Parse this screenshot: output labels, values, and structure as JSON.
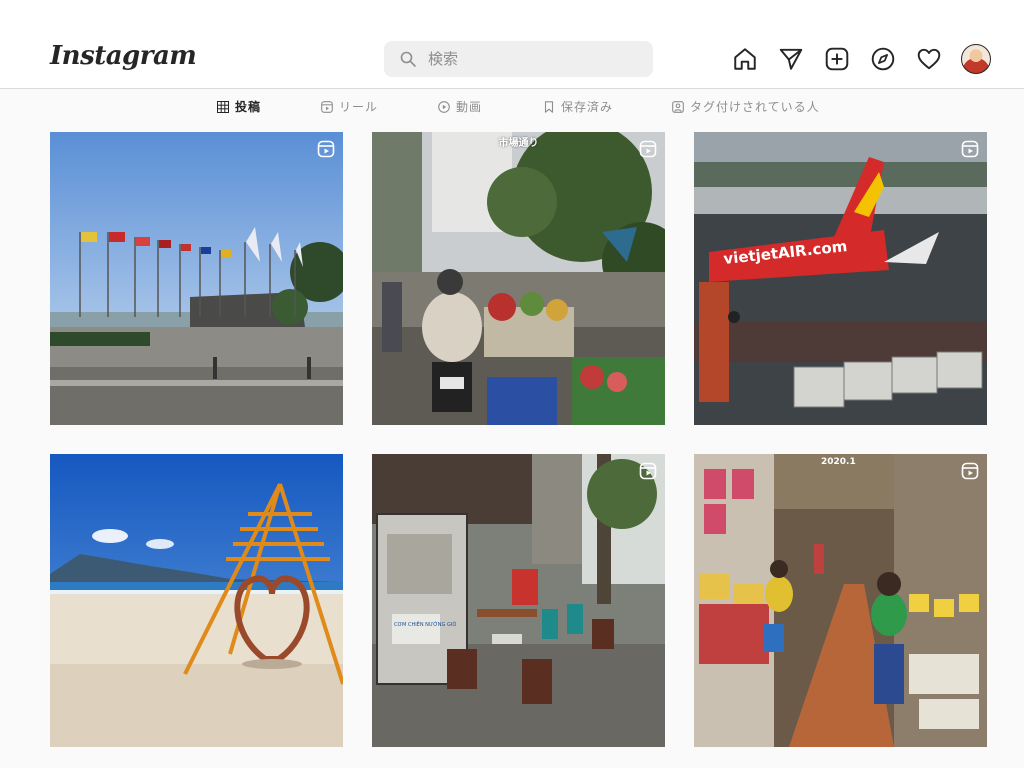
{
  "header": {
    "logo_text": "Instagram",
    "search": {
      "placeholder": "検索",
      "value": ""
    },
    "nav_icons": [
      "home-icon",
      "direct-message-icon",
      "new-post-icon",
      "explore-icon",
      "activity-heart-icon",
      "profile-avatar"
    ]
  },
  "tabs": [
    {
      "label": "投稿",
      "icon": "grid-icon",
      "active": true
    },
    {
      "label": "リール",
      "icon": "reels-icon",
      "active": false
    },
    {
      "label": "動画",
      "icon": "video-play-icon",
      "active": false
    },
    {
      "label": "保存済み",
      "icon": "bookmark-icon",
      "active": false
    },
    {
      "label": "タグ付けされている人",
      "icon": "tagged-user-icon",
      "active": false
    }
  ],
  "posts": [
    {
      "subject": "waterfront plaza with flags",
      "reel": true,
      "caption": ""
    },
    {
      "subject": "street market with motorbikes",
      "reel": true,
      "caption": "市場通り"
    },
    {
      "subject": "VietJet Air airplane at airport",
      "reel": true,
      "caption": "",
      "airline_text": "vietjetAIR.com"
    },
    {
      "subject": "beach with heart sculpture",
      "reel": false,
      "caption": ""
    },
    {
      "subject": "sidewalk food cart",
      "reel": true,
      "caption": "",
      "sign_text": "CƠM CHIÊN NƯỚNG GIÒ"
    },
    {
      "subject": "indoor market stalls",
      "reel": true,
      "caption": "2020.1"
    }
  ],
  "colors": {
    "accent": "#262626",
    "muted": "#8e8e8e",
    "border": "#dbdbdb",
    "search_bg": "#efefef"
  }
}
